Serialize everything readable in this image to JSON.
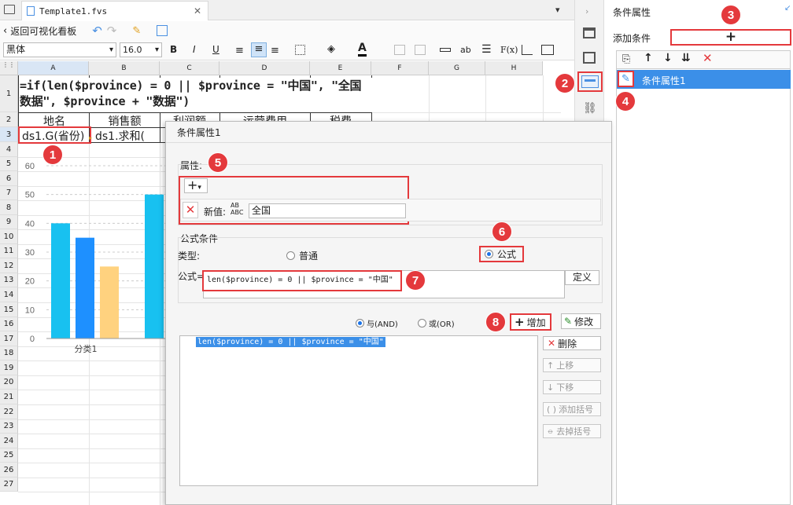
{
  "tab": {
    "title": "Template1.fvs"
  },
  "toolbar": {
    "back_label": "返回可视化看板",
    "font_name": "黑体",
    "font_size": "16.0",
    "bold": "B",
    "italic": "I",
    "underline": "U",
    "text_btn": "ab",
    "formula_btn": "F(x)"
  },
  "columns": [
    "A",
    "B",
    "C",
    "D",
    "E",
    "F",
    "G",
    "H"
  ],
  "rows": [
    "1",
    "2",
    "3",
    "4",
    "5",
    "6",
    "7",
    "8",
    "9",
    "10",
    "11",
    "12",
    "13",
    "14",
    "15",
    "16",
    "17",
    "18",
    "19",
    "20",
    "21",
    "22",
    "23",
    "24",
    "25",
    "26",
    "27"
  ],
  "cells": {
    "formula": "=if(len($province) = 0 || $province = \"中国\", \"全国数据\", $province + \"数据\")",
    "header": [
      "地名",
      "销售额",
      "利润额",
      "运营费用",
      "税费"
    ],
    "a3": "ds1.G(省份)",
    "b3": "ds1.求和("
  },
  "chart_data": {
    "type": "bar",
    "categories": [
      "分类1",
      ""
    ],
    "ylim": [
      0,
      60
    ],
    "yticks": [
      "60",
      "50",
      "40",
      "30",
      "20",
      "10",
      "0"
    ],
    "series": [
      {
        "values": [
          40,
          null
        ],
        "color": "#18c1f0"
      },
      {
        "values": [
          35,
          null
        ],
        "color": "#1e90ff"
      },
      {
        "values": [
          25,
          null
        ],
        "color": "#ffd27f"
      },
      {
        "values": [
          null,
          50
        ],
        "color": "#18c1f0"
      }
    ]
  },
  "dialog": {
    "title": "条件属性1",
    "attr_legend": "属性:",
    "new_value_label": "新值:",
    "new_value": "全国",
    "formula_legend": "公式条件",
    "type_label": "类型:",
    "type_normal": "普通",
    "type_formula": "公式",
    "formula_label": "公式=",
    "formula_value": "len($province) = 0 || $province = \"中国\"",
    "define_btn": "定义",
    "and_label": "与(AND)",
    "or_label": "或(OR)",
    "add_btn": "增加",
    "modify_btn": "修改",
    "condition_item": "len($province) = 0 || $province = \"中国\"",
    "delete_btn": "删除",
    "up_btn": "上移",
    "down_btn": "下移",
    "add_paren_btn": "添加括号",
    "remove_paren_btn": "去掉括号"
  },
  "right_panel": {
    "title": "条件属性",
    "add_label": "添加条件",
    "add_btn": "+",
    "item_label": "条件属性1"
  },
  "badges": [
    "1",
    "2",
    "3",
    "4",
    "5",
    "6",
    "7",
    "8"
  ],
  "colors": {
    "accent": "#4a90e2",
    "badge": "#e4393c",
    "selection": "#3b8fe8"
  }
}
